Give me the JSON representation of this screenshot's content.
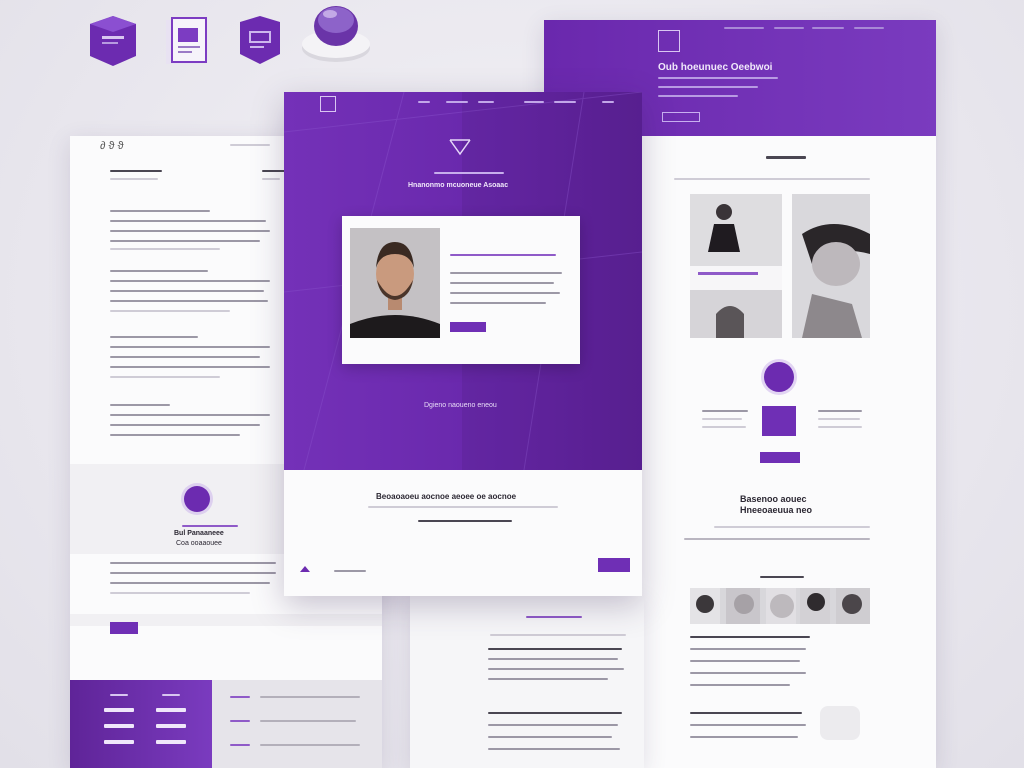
{
  "colors": {
    "accent": "#6c2bb0",
    "accent_light": "#8f5ac8",
    "panel": "#fbfbfc",
    "background": "#e9e7ee"
  },
  "icons": [
    "hexagon-badge-icon",
    "card-badge-icon",
    "shield-badge-icon",
    "push-button-icon",
    "logo-icon",
    "chevron-up-icon"
  ],
  "center_panel": {
    "hero_heading": "Hnanonmo mcuoneue Asoaac",
    "profile_caption": "Dgieno naoueno eneou",
    "footer_headline": "Beoaoaoeu aocnoe aeoee oe aocnoe"
  },
  "left_panel": {
    "section_title": "Bul Panaaneee",
    "section_sub": "Coa ooaaouee"
  },
  "right_panel": {
    "header_title": "Oub hoeunuec Oeebwoi",
    "mid_heading_line1": "Basenoo aouec",
    "mid_heading_line2": "Hneeoaeuua neo"
  }
}
